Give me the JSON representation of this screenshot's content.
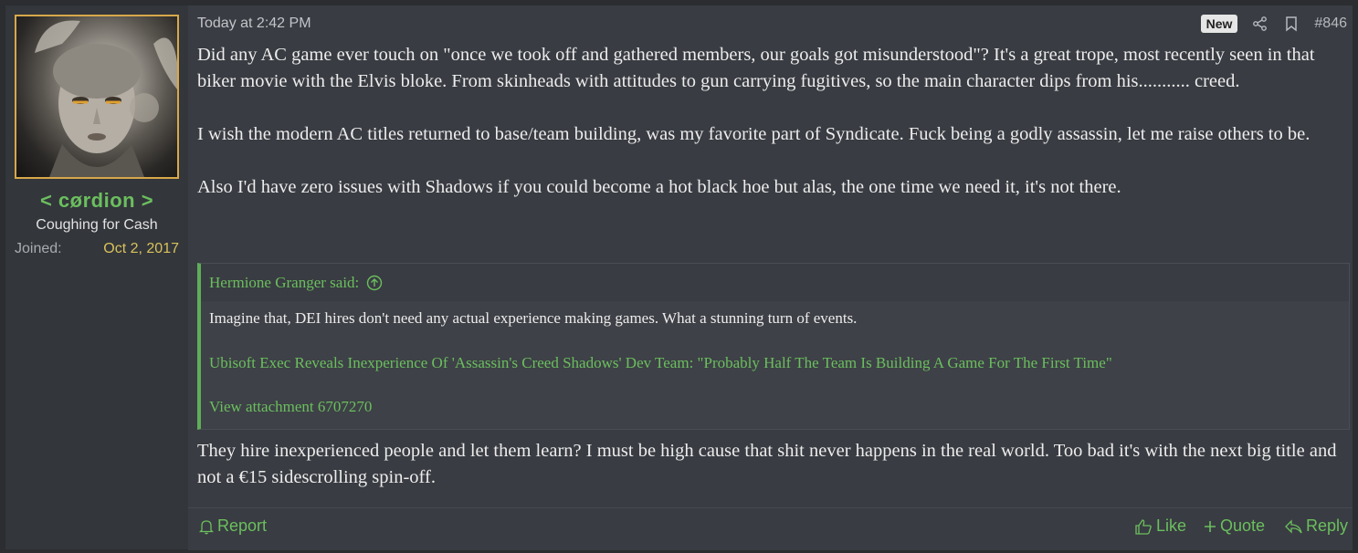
{
  "user": {
    "name": "< cørdion >",
    "title": "Coughing for Cash",
    "joined_label": "Joined:",
    "joined_date": "Oct 2, 2017"
  },
  "post": {
    "timestamp": "Today at 2:42 PM",
    "badge": "New",
    "number": "#846",
    "paragraphs": [
      "Did any AC game ever touch on \"once we took off and gathered members, our goals got misunderstood\"? It's a great trope, most recently seen in that biker movie with the Elvis bloke. From skinheads with attitudes to gun carrying fugitives, so the main character dips from his........... creed.",
      "I wish the modern AC titles returned to base/team building, was my favorite part of Syndicate. Fuck being a godly assassin, let me raise others to be.",
      "Also I'd have zero issues with Shadows if you could become a hot black hoe but alas, the one time we need it, it's not there."
    ],
    "after_quote": "They hire inexperienced people and let them learn? I must be high cause that shit never happens in the real world. Too bad it's with the next big title and not a €15 sidescrolling spin-off."
  },
  "quote": {
    "author": "Hermione Granger said:",
    "text": "Imagine that, DEI hires don't need any actual experience making games. What a stunning turn of events.",
    "link": "Ubisoft Exec Reveals Inexperience Of 'Assassin's Creed Shadows' Dev Team: \"Probably Half The Team Is Building A Game For The First Time\"",
    "attachment": "View attachment 6707270"
  },
  "footer": {
    "report": "Report",
    "like": "Like",
    "quote": "Quote",
    "reply": "Reply"
  },
  "colors": {
    "accent": "#6bbf5e",
    "avatar_border": "#d8a84a",
    "joined_date": "#d8c25a"
  }
}
